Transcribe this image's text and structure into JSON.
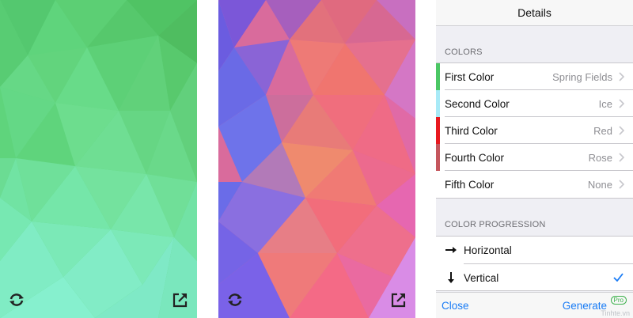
{
  "left_screen": {
    "gradient": [
      "#4fc56b",
      "#5dd98a",
      "#6ee6c4"
    ],
    "icons": {
      "left": "refresh-icon",
      "right": "share-icon"
    }
  },
  "middle_screen": {
    "gradient": [
      "#6e62e8",
      "#e46a86",
      "#f0627a",
      "#d883e6"
    ],
    "icons": {
      "left": "refresh-icon",
      "right": "share-icon"
    }
  },
  "details": {
    "title": "Details",
    "colors_header": "COLORS",
    "colors": [
      {
        "label": "First Color",
        "value": "Spring Fields",
        "swatch": "#4bc764"
      },
      {
        "label": "Second Color",
        "value": "Ice",
        "swatch": "#a8eaf7"
      },
      {
        "label": "Third Color",
        "value": "Red",
        "swatch": "#e8191f"
      },
      {
        "label": "Fourth Color",
        "value": "Rose",
        "swatch": "#c5565d"
      },
      {
        "label": "Fifth Color",
        "value": "None",
        "swatch": ""
      }
    ],
    "progression_header": "COLOR PROGRESSION",
    "progression": [
      {
        "label": "Horizontal",
        "icon": "arrow-right-icon",
        "selected": false
      },
      {
        "label": "Vertical",
        "icon": "arrow-down-icon",
        "selected": true
      }
    ],
    "toolbar": {
      "close": "Close",
      "generate": "Generate",
      "pro_badge": "Pro"
    },
    "watermark": "Tinhte.vn",
    "accent": "#1a7cf5"
  }
}
